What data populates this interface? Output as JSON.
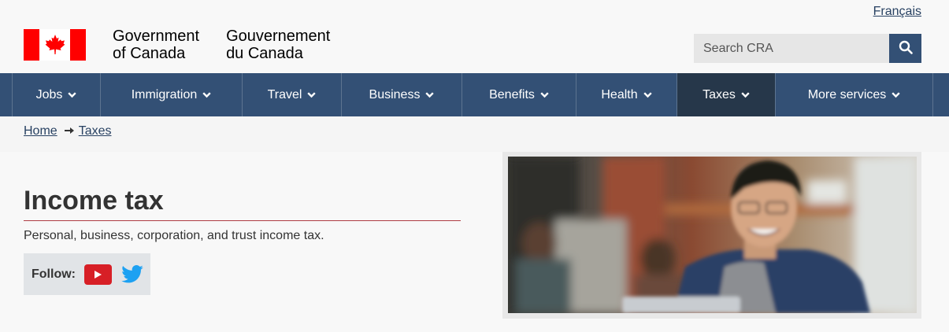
{
  "header": {
    "language_link": "Français",
    "gov_en_line1": "Government",
    "gov_en_line2": "of Canada",
    "gov_fr_line1": "Gouvernement",
    "gov_fr_line2": "du Canada",
    "flag_icon": "canada-flag-icon",
    "search": {
      "placeholder": "Search CRA",
      "value": "",
      "button_icon": "search-icon"
    }
  },
  "nav": {
    "items": [
      {
        "label": "Jobs"
      },
      {
        "label": "Immigration"
      },
      {
        "label": "Travel"
      },
      {
        "label": "Business"
      },
      {
        "label": "Benefits"
      },
      {
        "label": "Health"
      },
      {
        "label": "Taxes",
        "active": true
      },
      {
        "label": "More services"
      }
    ],
    "chevron_icon": "chevron-down-icon"
  },
  "breadcrumb": {
    "items": [
      "Home",
      "Taxes"
    ],
    "separator_icon": "arrow-right-icon"
  },
  "main": {
    "title": "Income tax",
    "lead": "Personal, business, corporation, and trust income tax.",
    "follow": {
      "label": "Follow:",
      "icons": [
        "youtube-icon",
        "twitter-icon"
      ]
    }
  },
  "colors": {
    "nav_bg": "#335075",
    "nav_active_bg": "#26374a",
    "link": "#284162",
    "rule": "#af3c43",
    "flag_red": "#ff0000",
    "youtube_red": "#d71f26",
    "twitter_blue": "#1da1f2"
  }
}
